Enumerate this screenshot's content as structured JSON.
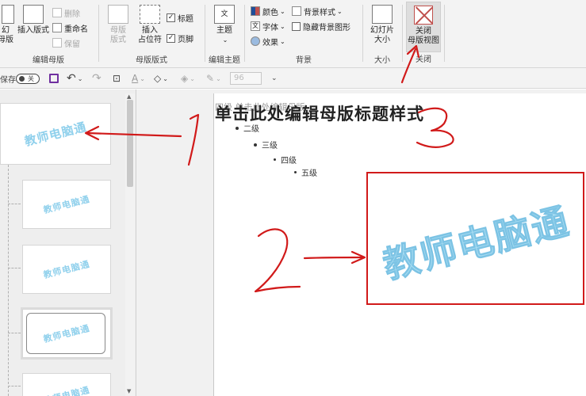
{
  "ribbon": {
    "groups": {
      "edit_master": {
        "label": "编辑母版",
        "insert_slide_master_line1": "幻",
        "insert_slide_master_line2": "母版",
        "insert_layout": "插入版式",
        "delete": "删除",
        "rename": "重命名",
        "preserve": "保留"
      },
      "master_layout": {
        "label": "母版版式",
        "master_layout_btn_line1": "母版",
        "master_layout_btn_line2": "版式",
        "insert_placeholder_line1": "插入",
        "insert_placeholder_line2": "占位符",
        "title_checkbox": "标题",
        "footer_checkbox": "页脚"
      },
      "edit_theme": {
        "label": "编辑主题",
        "themes": "主题"
      },
      "background": {
        "label": "背景",
        "colors": "颜色",
        "fonts": "字体",
        "effects": "效果",
        "background_styles": "背景样式",
        "hide_background_graphics": "隐藏背景图形"
      },
      "size": {
        "label": "大小",
        "slide_size_line1": "幻灯片",
        "slide_size_line2": "大小"
      },
      "close": {
        "label": "关闭",
        "close_line1": "关闭",
        "close_line2": "母版视图"
      }
    }
  },
  "qat": {
    "autosave_label": "保存",
    "autosave_state": "关",
    "zoom_value": "96"
  },
  "thumbnails": {
    "watermark": "教师电脑通"
  },
  "slide": {
    "title": "单击此处编辑母版标题样式",
    "title_overlay": "四级 单击此处编辑母版",
    "bullets": [
      "二级",
      "三级",
      "四级",
      "五级"
    ],
    "picture_watermark": "教师电脑通"
  },
  "annotations": {
    "one": "1",
    "two": "2",
    "three": "3",
    "color": "#d11a1a"
  }
}
